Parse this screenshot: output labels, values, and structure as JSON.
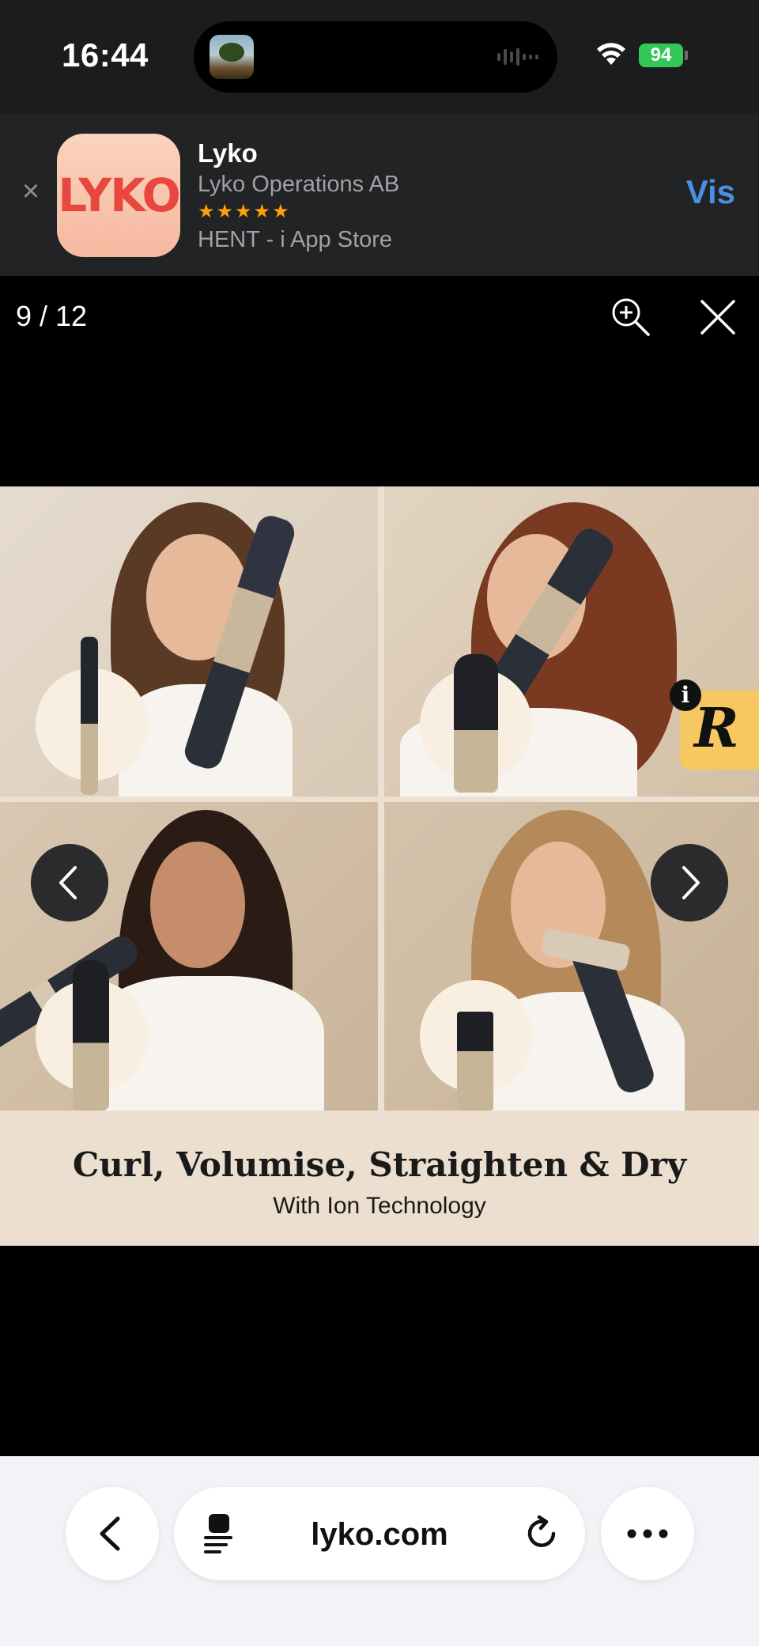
{
  "status_bar": {
    "time": "16:44",
    "battery": "94"
  },
  "app_banner": {
    "icon_text": "LYKO",
    "app_name": "Lyko",
    "developer": "Lyko Operations AB",
    "stars": "★★★★★",
    "rating": 5,
    "get_text": "HENT - i App Store",
    "action_label": "Vis",
    "close_icon": "close-icon"
  },
  "viewer": {
    "counter": "9 / 12",
    "zoom_icon": "zoom-in-icon",
    "close_icon": "close-icon"
  },
  "image": {
    "caption_title": "Curl, Volumise, Straighten & Dry",
    "caption_subtitle": "With Ion Technology",
    "badge_letter": "R",
    "info_letter": "i"
  },
  "navigation": {
    "prev_icon": "chevron-left-icon",
    "next_icon": "chevron-right-icon"
  },
  "toolbar": {
    "url": "lyko.com",
    "back_icon": "chevron-left-icon",
    "reader_icon": "page-menu-icon",
    "reload_icon": "reload-icon",
    "more_icon": "more-icon"
  },
  "colors": {
    "accent_link": "#4a90e2",
    "battery": "#32c759",
    "stars": "#ff9f0a",
    "brand": "#e8473f"
  }
}
